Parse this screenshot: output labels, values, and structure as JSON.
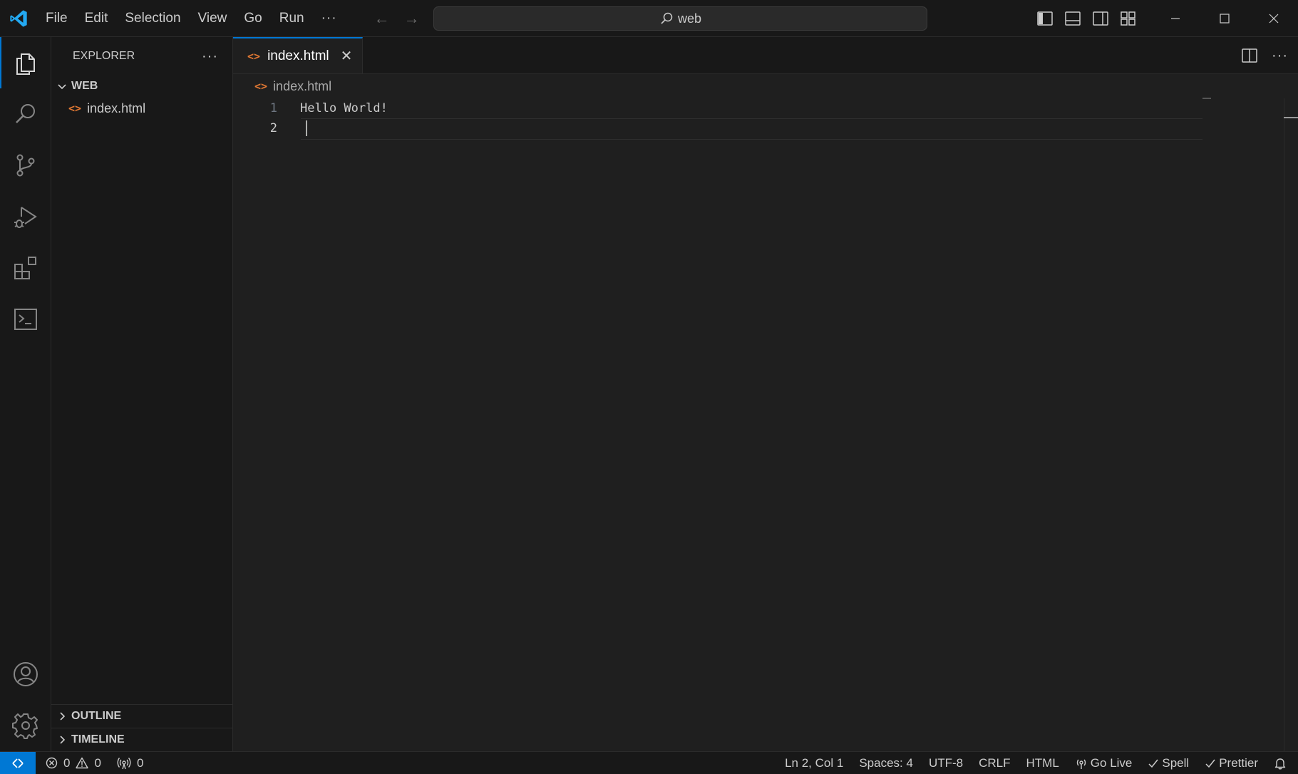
{
  "menu": [
    "File",
    "Edit",
    "Selection",
    "View",
    "Go",
    "Run"
  ],
  "menu_more": "···",
  "search": {
    "text": "web"
  },
  "explorer": {
    "title": "EXPLORER",
    "more": "···",
    "folder": "WEB",
    "files": [
      "index.html"
    ],
    "outline": "OUTLINE",
    "timeline": "TIMELINE"
  },
  "tab": {
    "label": "index.html",
    "close": "✕"
  },
  "breadcrumb": "index.html",
  "editor": {
    "lines": [
      {
        "number": "1",
        "text": "Hello World!"
      },
      {
        "number": "2",
        "text": ""
      }
    ]
  },
  "status": {
    "errors": "0",
    "warnings": "0",
    "ports": "0",
    "position": "Ln 2, Col 1",
    "spaces": "Spaces: 4",
    "encoding": "UTF-8",
    "eol": "CRLF",
    "language": "HTML",
    "golive": "Go Live",
    "spell": "Spell",
    "prettier": "Prettier"
  },
  "colors": {
    "accent": "#0078d4",
    "html_icon": "#e37933",
    "logo": "#23a9f2"
  }
}
